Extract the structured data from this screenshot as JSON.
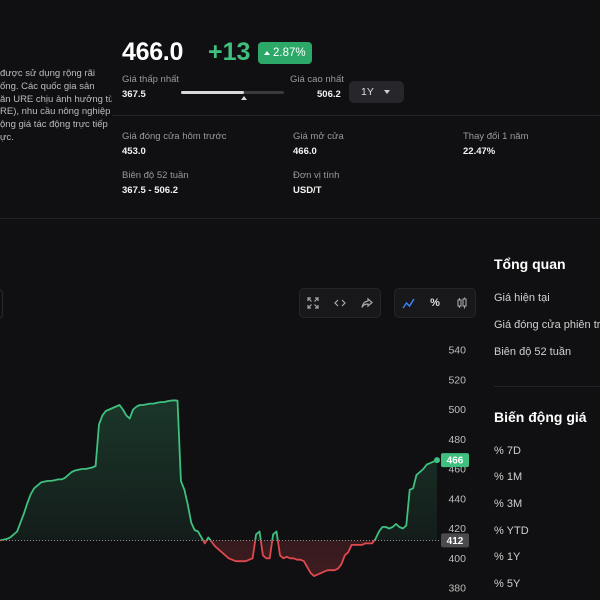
{
  "description": {
    "lines": [
      "được sử dụng rộng rãi",
      "ống. Các quốc gia sản",
      "ăn URE chịu ảnh hưởng từ",
      "RE), nhu cầu nông nghiệp",
      "ộng giá tác động trực tiếp",
      "ực."
    ]
  },
  "header": {
    "price": "466.0",
    "change": "+13",
    "change_pct": "2.87%",
    "low_label": "Giá thấp nhất",
    "low_value": "367.5",
    "high_label": "Giá cao nhất",
    "high_value": "506.2",
    "range_position": 0.61,
    "period": "1Y"
  },
  "stats": [
    {
      "label": "Giá đóng cửa hôm trước",
      "value": "453.0"
    },
    {
      "label": "Giá mở cửa",
      "value": "466.0"
    },
    {
      "label": "Thay đổi 1 năm",
      "value": "22.47%"
    },
    {
      "label": "Biên độ 52 tuần",
      "value": "367.5 - 506.2"
    },
    {
      "label": "Đơn vị tính",
      "value": "USD/T"
    }
  ],
  "chart_toolbar": {
    "fullscreen_icon": "expand-icon",
    "embed_icon": "code-icon",
    "share_icon": "share-icon",
    "line_icon": "line-chart-icon",
    "percent_label": "%",
    "candle_icon": "candlestick-icon"
  },
  "chart_data": {
    "type": "line",
    "yticks": [
      "540",
      "520",
      "500",
      "480",
      "460",
      "440",
      "420",
      "400",
      "380"
    ],
    "ylim": [
      380,
      540
    ],
    "baseline": 412,
    "baseline_label": "412",
    "current_label": "466",
    "colors": {
      "up": "#3fc07f",
      "down": "#e0484f"
    },
    "values": [
      412,
      412.5,
      413,
      414,
      416,
      418,
      424,
      430,
      437,
      443,
      447,
      449,
      451,
      451.5,
      452,
      452,
      452.5,
      453,
      453,
      454,
      456,
      458,
      459,
      459.5,
      460,
      460,
      460.5,
      461,
      462,
      490,
      496,
      499,
      500,
      501,
      502,
      503,
      500,
      496,
      494,
      500,
      502,
      503,
      503,
      503.5,
      504,
      504,
      504.5,
      505,
      505,
      505.5,
      506,
      506.2,
      506,
      452,
      446,
      436,
      424,
      419,
      418,
      414,
      410,
      414,
      411,
      408,
      406,
      404,
      402,
      400,
      399,
      398,
      398,
      398,
      398,
      399,
      400,
      416,
      418,
      402,
      400,
      400,
      416,
      418,
      402,
      400,
      401,
      400,
      400,
      399,
      399,
      398,
      394,
      390,
      388,
      389,
      390,
      391,
      392,
      392,
      392,
      393,
      396,
      402,
      404,
      409,
      409,
      409,
      409,
      410,
      410,
      410,
      413,
      418,
      421,
      421,
      420,
      421,
      423,
      421,
      420,
      422,
      446,
      447,
      456,
      458,
      460,
      463,
      464,
      465,
      466
    ]
  },
  "overview": {
    "title": "Tổng quan",
    "items": [
      "Giá hiện tại",
      "Giá đóng cửa phiên trước",
      "Biên độ 52 tuần"
    ]
  },
  "price_change": {
    "title": "Biến động giá",
    "items": [
      "% 7D",
      "% 1M",
      "% 3M",
      "% YTD",
      "% 1Y",
      "% 5Y"
    ]
  }
}
